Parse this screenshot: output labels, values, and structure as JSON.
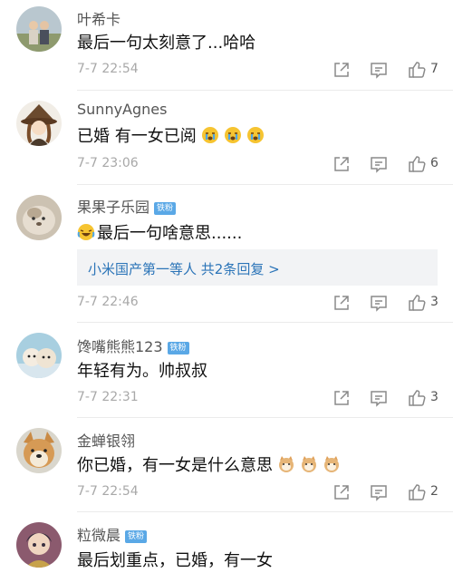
{
  "comments": [
    {
      "name": "叶希卡",
      "text": "最后一句太刻意了...哈哈",
      "time": "7-7 22:54",
      "likes": "7",
      "badge": ""
    },
    {
      "name": "SunnyAgnes",
      "text": "已婚 有一女已阅",
      "time": "7-7 23:06",
      "likes": "6",
      "badge": "",
      "emoji": [
        "crying-face-icon",
        "crying-face-icon",
        "crying-face-icon"
      ]
    },
    {
      "name": "果果子乐园",
      "badge": "铁粉",
      "text": "最后一句啥意思......",
      "time": "7-7 22:46",
      "likes": "3",
      "lead_emoji": "laughing-tears-face-icon",
      "reply": {
        "text": "小米国产第一等人  共2条回复 >"
      }
    },
    {
      "name": "馋嘴熊熊123",
      "badge": "铁粉",
      "text": "年轻有为。帅叔叔",
      "time": "7-7 22:31",
      "likes": "3"
    },
    {
      "name": "金蝉银翎",
      "badge": "",
      "text": "你已婚，有一女是什么意思",
      "time": "7-7 22:54",
      "likes": "2",
      "emoji": [
        "cat-face-icon",
        "cat-face-icon",
        "cat-face-icon"
      ]
    },
    {
      "name": "粒微晨",
      "badge": "铁粉",
      "text": "最后划重点，已婚，有一女"
    }
  ],
  "colors": {
    "badge": "#5aa8e6",
    "link": "#2b74b8",
    "time": "#a8a8a8"
  }
}
